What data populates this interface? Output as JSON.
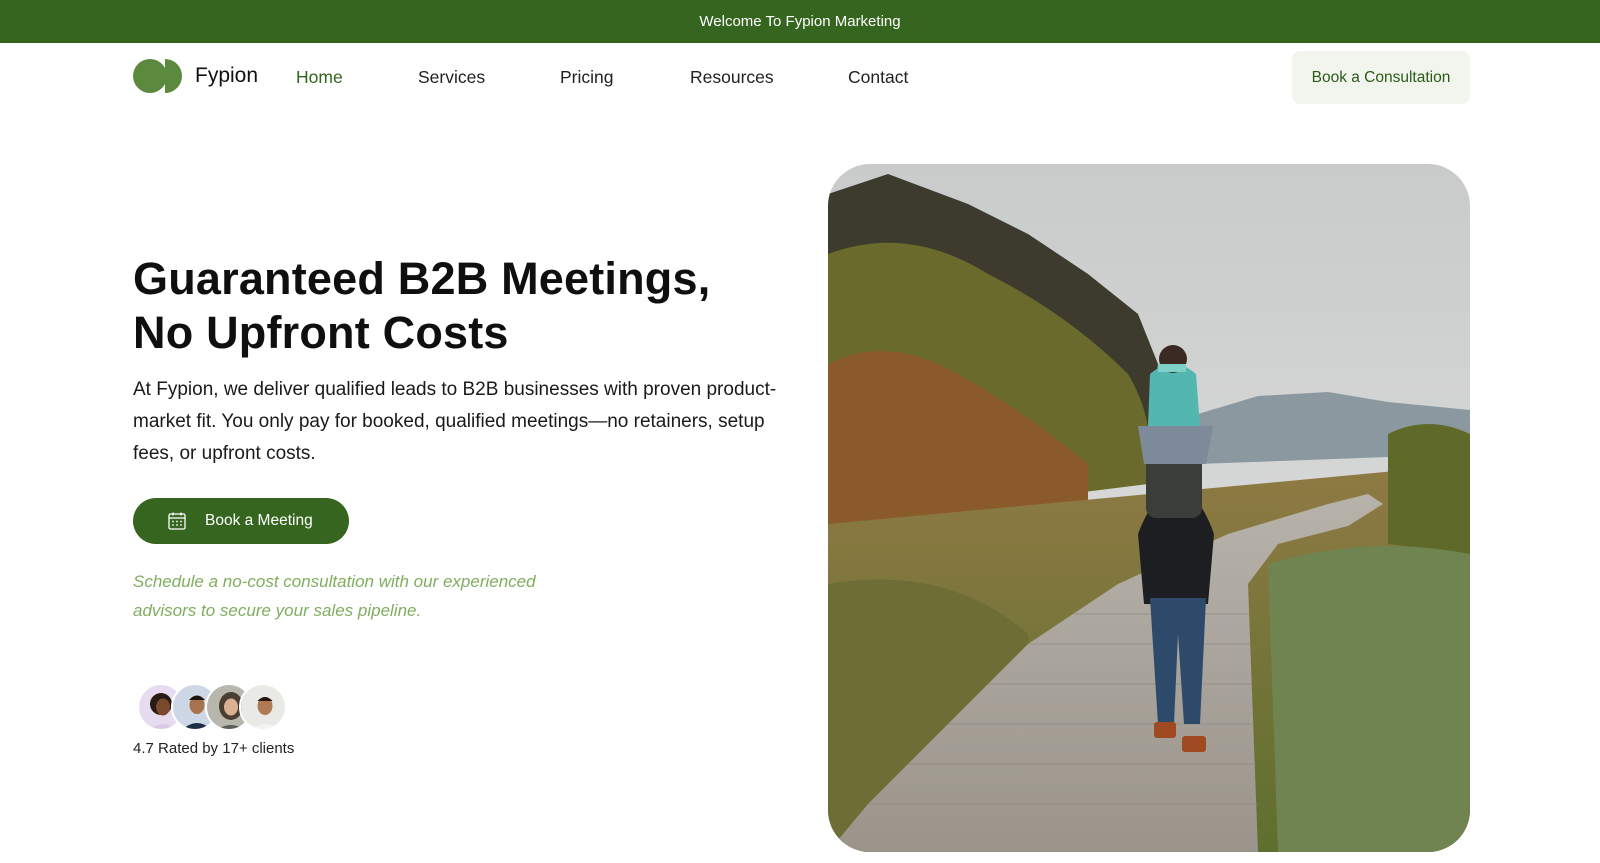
{
  "topbar": {
    "text": "Welcome To Fypion Marketing"
  },
  "brand": {
    "name": "Fypion",
    "logo_icon": "two-circle-logo-icon",
    "color": "#5b8a3e"
  },
  "nav": {
    "items": [
      {
        "label": "Home",
        "active": true
      },
      {
        "label": "Services",
        "active": false
      },
      {
        "label": "Pricing",
        "active": false
      },
      {
        "label": "Resources",
        "active": false
      },
      {
        "label": "Contact",
        "active": false
      }
    ],
    "cta_label": "Book a Consultation"
  },
  "hero": {
    "headline_line1": "Guaranteed B2B Meetings,",
    "headline_line2": "No Upfront Costs",
    "lead": "At Fypion, we deliver qualified leads to B2B businesses with proven product-market fit. You only pay for booked, qualified meetings—no retainers, setup fees, or upfront costs.",
    "button_label": "Book a Meeting",
    "button_icon": "calendar-icon",
    "note": "Schedule a no-cost consultation with our experienced advisors to secure your sales pipeline.",
    "rating_text": "4.7 Rated by 17+ clients",
    "client_count": 4
  },
  "colors": {
    "primary": "#35651e",
    "accent_light": "#f1f5ed",
    "note_text": "#7fae5f"
  }
}
